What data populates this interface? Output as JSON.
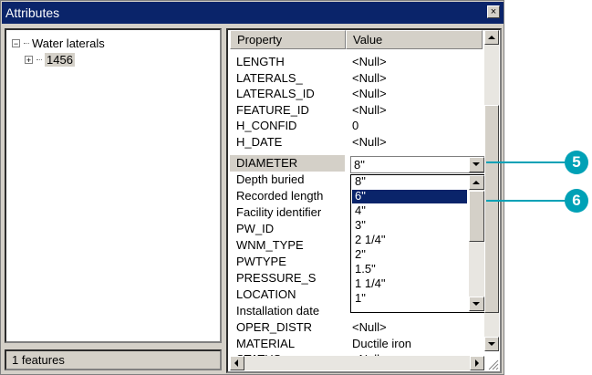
{
  "window": {
    "title": "Attributes",
    "close_label": "×"
  },
  "tree": {
    "root": {
      "expander": "−",
      "label": "Water laterals"
    },
    "child": {
      "expander": "+",
      "label": "1456"
    }
  },
  "status": {
    "text": "1 features"
  },
  "grid": {
    "headers": {
      "property": "Property",
      "value": "Value"
    },
    "rows": [
      {
        "property": "LENGTH",
        "value": "<Null>"
      },
      {
        "property": "LATERALS_",
        "value": "<Null>"
      },
      {
        "property": "LATERALS_ID",
        "value": "<Null>"
      },
      {
        "property": "FEATURE_ID",
        "value": "<Null>"
      },
      {
        "property": "H_CONFID",
        "value": "0"
      },
      {
        "property": "H_DATE",
        "value": "<Null>"
      },
      {
        "property": "DIAMETER",
        "value": ""
      },
      {
        "property": "Depth buried",
        "value": ""
      },
      {
        "property": "Recorded length",
        "value": ""
      },
      {
        "property": "Facility identifier",
        "value": ""
      },
      {
        "property": "PW_ID",
        "value": ""
      },
      {
        "property": "WNM_TYPE",
        "value": ""
      },
      {
        "property": "PWTYPE",
        "value": ""
      },
      {
        "property": "PRESSURE_S",
        "value": ""
      },
      {
        "property": "LOCATION",
        "value": ""
      },
      {
        "property": "Installation date",
        "value": ""
      },
      {
        "property": "OPER_DISTR",
        "value": "<Null>"
      },
      {
        "property": "MATERIAL",
        "value": "Ductile iron"
      },
      {
        "property": "STATUS",
        "value": "<Null>"
      }
    ],
    "selected_row": "DIAMETER"
  },
  "combo": {
    "value": "8\"",
    "options": [
      "8\"",
      "6\"",
      "4\"",
      "3\"",
      "2 1/4\"",
      "2\"",
      "1.5\"",
      "1 1/4\"",
      "1\""
    ],
    "highlighted": "6\""
  },
  "callouts": {
    "first": "5",
    "second": "6"
  },
  "colors": {
    "title_bar": "#0a246a",
    "highlight": "#0a246a",
    "callout": "#00a1b6",
    "chrome": "#d4d0c8"
  }
}
